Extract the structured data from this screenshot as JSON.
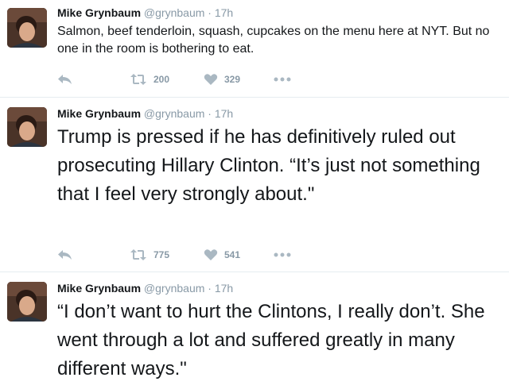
{
  "tweets": [
    {
      "name": "Mike Grynbaum",
      "handle": "@grynbaum",
      "separator": "·",
      "time": "17h",
      "text": "Salmon, beef tenderloin, squash, cupcakes on the menu here at NYT. But no one in the room is bothering to eat.",
      "retweets": "200",
      "likes": "329",
      "icons": [
        "reply-icon",
        "retweet-icon",
        "heart-icon",
        "more-icon"
      ]
    },
    {
      "name": "Mike Grynbaum",
      "handle": "@grynbaum",
      "separator": "·",
      "time": "17h",
      "text": "Trump is pressed if he has definitively ruled out prosecuting Hillary Clinton. “It’s just not something that I feel very strongly about.\"",
      "retweets": "775",
      "likes": "541",
      "icons": [
        "reply-icon",
        "retweet-icon",
        "heart-icon",
        "more-icon"
      ]
    },
    {
      "name": "Mike Grynbaum",
      "handle": "@grynbaum",
      "separator": "·",
      "time": "17h",
      "text": "“I don’t want to hurt the Clintons, I really don’t. She went through a lot and suffered greatly in many different ways.\""
    }
  ],
  "colors": {
    "icon": "#aab8c2",
    "meta": "#8899a6",
    "divider": "#e6ecf0"
  }
}
